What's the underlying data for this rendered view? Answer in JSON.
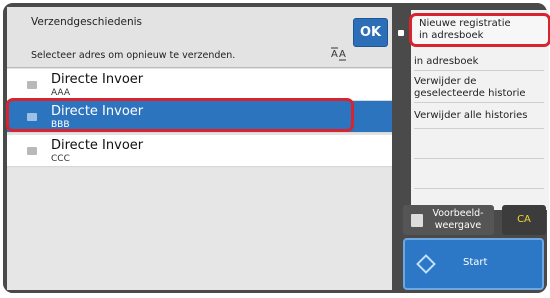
{
  "header": {
    "title": "Verzendgeschiedenis",
    "ok_label": "OK"
  },
  "instruction": "Selecteer adres om opnieuw te verzenden.",
  "sort_icon_label": "A̅⁠A",
  "rows": [
    {
      "name": "Directe Invoer",
      "sub": "AAA"
    },
    {
      "name": "Directe Invoer",
      "sub": "BBB"
    },
    {
      "name": "Directe Invoer",
      "sub": "CCC"
    }
  ],
  "menu": {
    "highlighted_item": "Nieuwe registratie\nin adresboek",
    "items": [
      "in adresboek",
      "Verwijder de\ngeselecteerde historie",
      "Verwijder alle histories"
    ]
  },
  "buttons": {
    "preview": "Voorbeeld-\nweergave",
    "ca": "CA",
    "start": "Start"
  },
  "icons": {
    "row_icon": "envelope-icon",
    "sort_icon": "sort-az-icon",
    "preview_icon": "preview-icon",
    "start_icon": "start-diamond-icon"
  },
  "colors": {
    "accent": "#2d74bf",
    "highlight": "#d8242f",
    "ca_text": "#f2d23a"
  }
}
